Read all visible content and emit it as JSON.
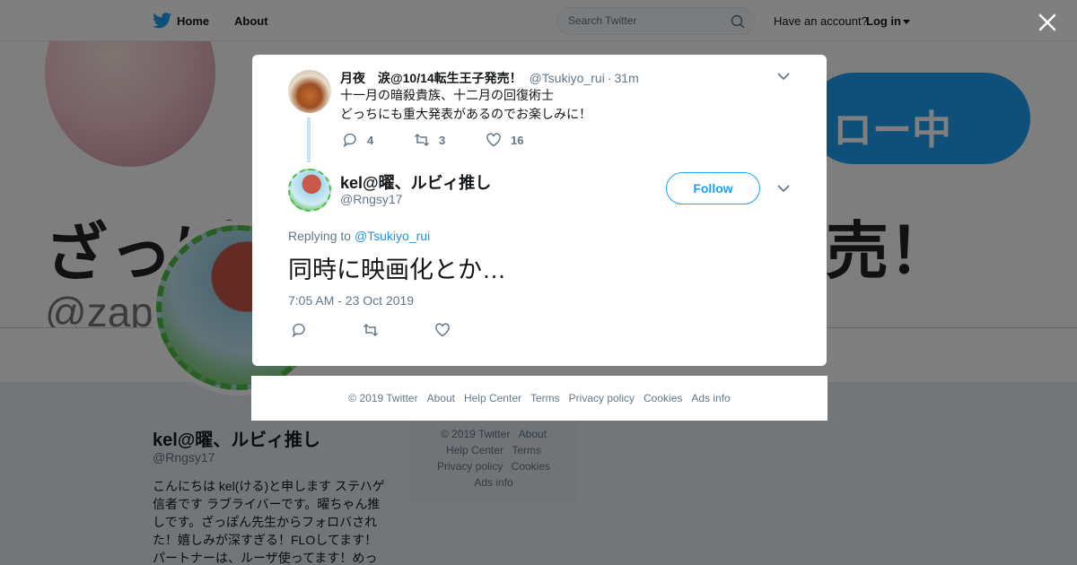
{
  "nav": {
    "home": "Home",
    "about": "About",
    "search_placeholder": "Search Twitter",
    "have_account": "Have an account?",
    "login": "Log in"
  },
  "banner": {
    "bigtext": "ざっぽ",
    "rightbig": "売！",
    "handle": "@zap",
    "follow_text": "ロー中"
  },
  "profile": {
    "name": "kel@曜、ルビィ推し",
    "handle": "@Rngsy17",
    "bio": "こんにちは kel(ける)と申します ステハゲ信者です ラブライバーです。曜ちゃん推しです。ざっぽん先生からフォロバされた！嬉しみが深すぎる！FLOしてます！パートナーは、ルーザ使ってます！めっ"
  },
  "side_footer": {
    "copyright": "© 2019 Twitter",
    "about": "About",
    "help": "Help Center",
    "terms": "Terms",
    "privacy": "Privacy policy",
    "cookies": "Cookies",
    "ads": "Ads info"
  },
  "parent_tweet": {
    "name": "月夜　涙@10/14転生王子発売！",
    "handle": "@Tsukiyo_rui",
    "time": "31m",
    "text": "十一月の暗殺貴族、十二月の回復術士\nどっちにも重大発表があるのでお楽しみに！",
    "replies": "4",
    "retweets": "3",
    "likes": "16"
  },
  "main_tweet": {
    "name": "kel@曜、ルビィ推し",
    "handle": "@Rngsy17",
    "follow_label": "Follow",
    "replying_label": "Replying to",
    "replying_handle": "@Tsukiyo_rui",
    "text": "同時に映画化とか…",
    "date": "7:05 AM - 23 Oct 2019"
  },
  "modal_footer": {
    "copyright": "© 2019 Twitter",
    "about": "About",
    "help": "Help Center",
    "terms": "Terms",
    "privacy": "Privacy policy",
    "cookies": "Cookies",
    "ads": "Ads info"
  },
  "colors": {
    "brand": "#1da1f2",
    "link": "#1b95e0",
    "muted": "#657786"
  },
  "icons": [
    "twitter-logo-icon",
    "search-icon",
    "close-icon",
    "chevron-down-icon",
    "reply-icon",
    "retweet-icon",
    "like-icon"
  ]
}
